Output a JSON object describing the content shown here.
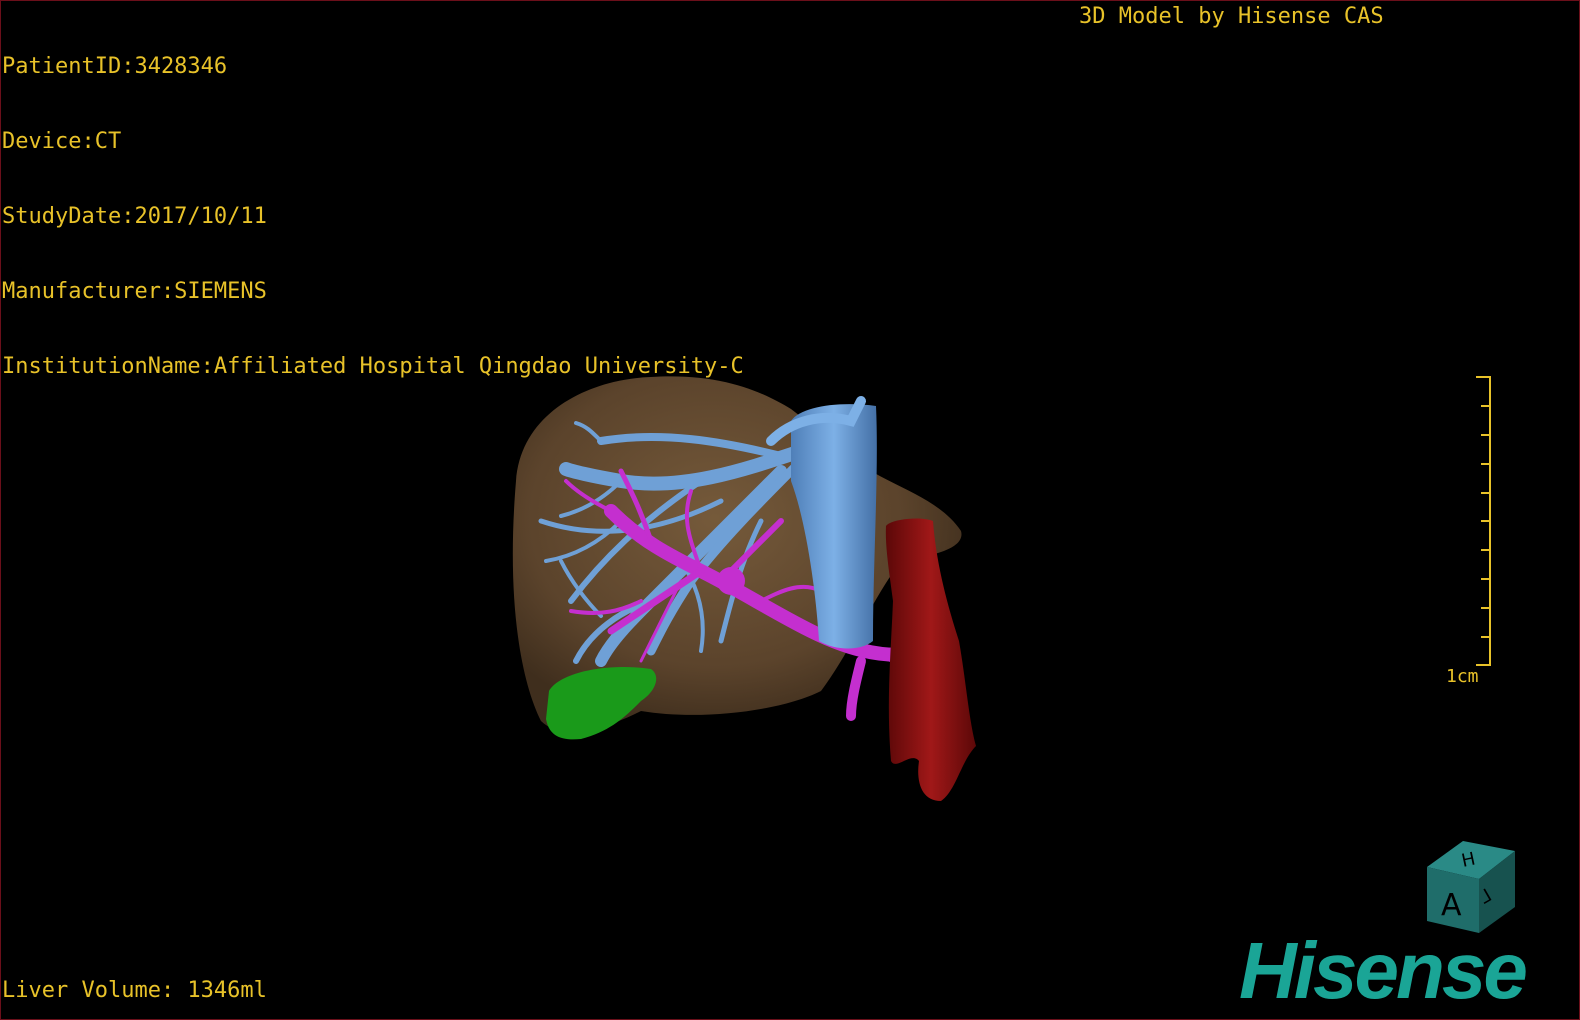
{
  "header": {
    "patient_id": "PatientID:3428346",
    "device": "Device:CT",
    "study_date": "StudyDate:2017/10/11",
    "manufacturer": "Manufacturer:SIEMENS",
    "institution": "InstitutionName:Affiliated Hospital Qingdao University-C",
    "credit": "3D Model by Hisense CAS"
  },
  "footer": {
    "liver_volume": "Liver Volume: 1346ml"
  },
  "ruler": {
    "label": "1cm"
  },
  "orientation_cube": {
    "top_face": "H",
    "front_face": "A",
    "side_face": "L"
  },
  "brand": {
    "logo_text": "Hisense"
  },
  "colors": {
    "overlay_text": "#e8c229",
    "liver": "#7a5a3a",
    "hepatic_vein": "#6fa0d6",
    "portal_vein": "#c42fcf",
    "aorta": "#8a1010",
    "gallbladder": "#1a9a1a",
    "brand": "#1aa596"
  },
  "icons": {
    "orientation_cube": "orientation-cube-icon"
  }
}
